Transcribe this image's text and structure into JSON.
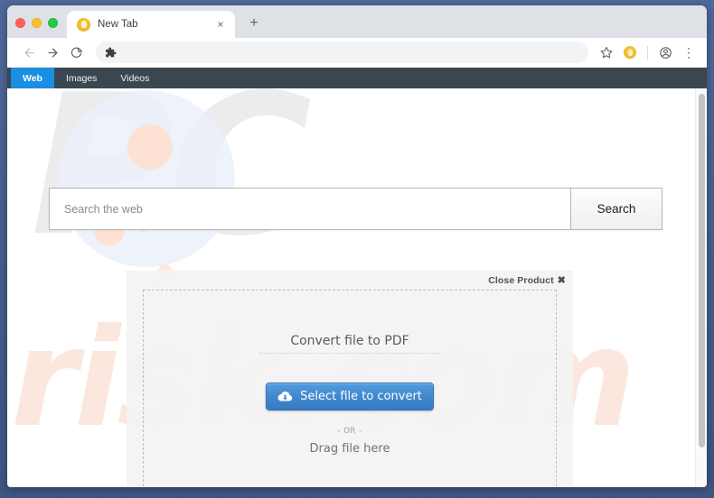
{
  "window": {
    "traffic_lights": [
      "close",
      "minimize",
      "maximize"
    ]
  },
  "tabstrip": {
    "tab_title": "New Tab",
    "favicon_name": "lightbulb-favicon",
    "close_glyph": "×",
    "new_tab_glyph": "+"
  },
  "toolbar": {
    "back_label": "Back",
    "forward_label": "Forward",
    "reload_label": "Reload",
    "omnibox_value": "",
    "omnibox_placeholder": "",
    "extension_puzzle_name": "puzzle-piece-icon",
    "bookmark_label": "Bookmark this page",
    "extension_badge_name": "extension-icon",
    "profile_label": "Profile",
    "menu_glyph": "⋮"
  },
  "nav_strip": {
    "tabs": [
      {
        "label": "Web",
        "active": true
      },
      {
        "label": "Images",
        "active": false
      },
      {
        "label": "Videos",
        "active": false
      }
    ],
    "active_color": "#1a8ee0",
    "bar_color": "#3a4750"
  },
  "search": {
    "placeholder": "Search the web",
    "value": "",
    "button_label": "Search"
  },
  "watermark": {
    "top_text": "PC",
    "bottom_text": "risk.com",
    "top_color": "#ececec",
    "bottom_color": "#fbe7de"
  },
  "pdf_widget": {
    "close_label": "Close Product",
    "close_glyph": "✖",
    "title": "Convert file to PDF",
    "button_label": "Select file to convert",
    "button_icon": "cloud-upload-icon",
    "or_label": "- OR -",
    "drag_label": "Drag file here",
    "button_color": "#3b84cd",
    "panel_color": "#f4f4f4"
  }
}
